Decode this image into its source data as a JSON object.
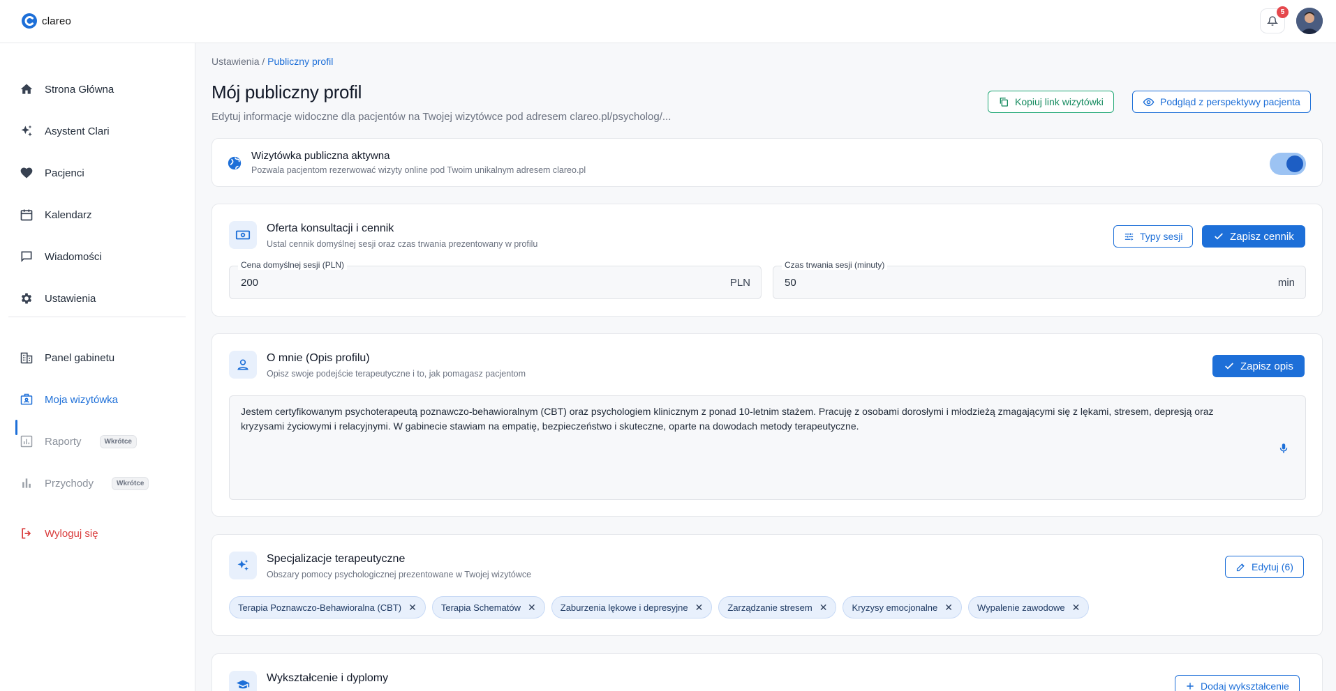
{
  "app": {
    "name": "clareo"
  },
  "header": {
    "notifications_count": "5"
  },
  "sidebar": {
    "items": [
      {
        "label": "Strona Główna"
      },
      {
        "label": "Asystent Clari"
      },
      {
        "label": "Pacjenci"
      },
      {
        "label": "Kalendarz"
      },
      {
        "label": "Wiadomości"
      },
      {
        "label": "Ustawienia"
      },
      {
        "label": "Panel gabinetu"
      },
      {
        "label": "Moja wizytówka"
      },
      {
        "label": "Raporty",
        "badge": "Wkrótce"
      },
      {
        "label": "Przychody",
        "badge": "Wkrótce"
      }
    ],
    "logout_label": "Wyloguj się"
  },
  "breadcrumb": {
    "parent": "Ustawienia",
    "separator": " / ",
    "current": "Publiczny profil"
  },
  "page": {
    "title": "Mój publiczny profil",
    "subtitle": "Edytuj informacje widoczne dla pacjentów na Twojej wizytówce pod adresem clareo.pl/psycholog/...",
    "copy_link_label": "Kopiuj link wizytówki",
    "preview_label": "Podgląd z perspektywy pacjenta"
  },
  "public_card": {
    "title": "Wizytówka publiczna aktywna",
    "subtitle": "Pozwala pacjentom rezerwować wizyty online pod Twoim unikalnym adresem clareo.pl",
    "enabled": true
  },
  "pricing": {
    "title": "Oferta konsultacji i cennik",
    "subtitle": "Ustal cennik domyślnej sesji oraz czas trwania prezentowany w profilu",
    "session_types_label": "Typy sesji",
    "save_label": "Zapisz cennik",
    "price_label": "Cena domyślnej sesji (PLN)",
    "price_value": "200",
    "price_suffix": "PLN",
    "duration_label": "Czas trwania sesji (minuty)",
    "duration_value": "50",
    "duration_suffix": "min"
  },
  "about": {
    "title": "O mnie (Opis profilu)",
    "subtitle": "Opisz swoje podejście terapeutyczne i to, jak pomagasz pacjentom",
    "save_label": "Zapisz opis",
    "text": "Jestem certyfikowanym psychoterapeutą poznawczo-behawioralnym (CBT) oraz psychologiem klinicznym z ponad 10-letnim stażem. Pracuję z osobami dorosłymi i młodzieżą zmagającymi się z lękami, stresem, depresją oraz kryzysami życiowymi i relacyjnymi. W gabinecie stawiam na empatię, bezpieczeństwo i skuteczne, oparte na dowodach metody terapeutyczne."
  },
  "specializations": {
    "title": "Specjalizacje terapeutyczne",
    "subtitle": "Obszary pomocy psychologicznej prezentowane w Twojej wizytówce",
    "edit_label": "Edytuj (6)",
    "tags": [
      "Terapia Poznawczo-Behawioralna (CBT)",
      "Terapia Schematów",
      "Zaburzenia lękowe i depresyjne",
      "Zarządzanie stresem",
      "Kryzysy emocjonalne",
      "Wypalenie zawodowe"
    ]
  },
  "education": {
    "title": "Wykształcenie i dyplomy",
    "add_label": "Dodaj wykształcenie"
  },
  "colors": {
    "accent": "#1d6fd8",
    "success": "#148a5e",
    "danger": "#d93b3b",
    "badge": "#e5484d"
  },
  "icons": {
    "home": "home-icon",
    "assistant": "sparkles-icon",
    "patients": "heart-icon",
    "calendar": "calendar-icon",
    "messages": "chat-icon",
    "settings": "gear-icon",
    "clinic": "building-icon",
    "card": "id-card-icon",
    "reports": "chart-icon",
    "revenue": "bar-chart-icon",
    "logout": "logout-icon"
  }
}
